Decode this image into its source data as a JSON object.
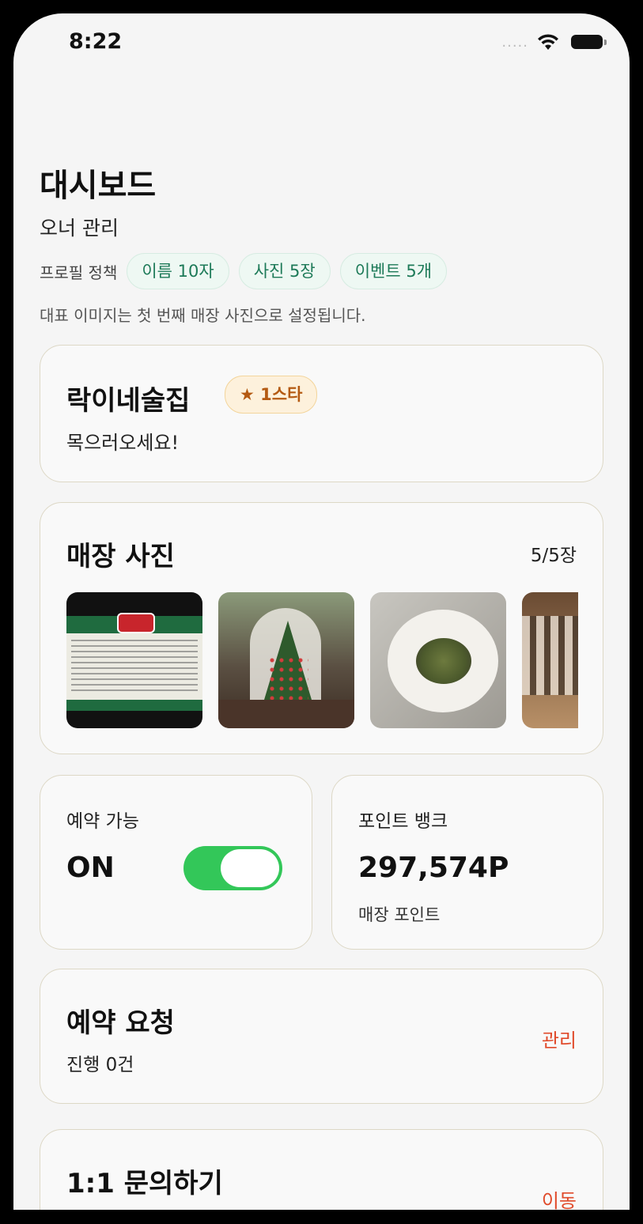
{
  "status": {
    "time": "8:22",
    "signal": "....."
  },
  "header": {
    "title": "대시보드",
    "subtitle": "오너 관리",
    "policy_label": "프로필 정책",
    "chips": [
      "이름 10자",
      "사진 5장",
      "이벤트 5개"
    ],
    "note": "대표 이미지는 첫 번째 매장 사진으로 설정됩니다."
  },
  "store": {
    "name": "락이네술집",
    "badge": "★ 1스타",
    "description": "목으러오세요!"
  },
  "photos": {
    "title": "매장 사진",
    "count": "5/5장"
  },
  "reservation": {
    "label": "예약 가능",
    "state": "ON",
    "enabled": true
  },
  "points": {
    "label": "포인트 뱅크",
    "value": "297,574P",
    "sub": "매장 포인트"
  },
  "requests": {
    "title": "예약 요청",
    "sub": "진행 0건",
    "link": "관리"
  },
  "inquiry": {
    "title": "1:1 문의하기",
    "link": "이동"
  },
  "colors": {
    "toggle_on": "#33c759",
    "link": "#e04a2a",
    "chip_text": "#1d7a58",
    "badge_text": "#b45a12"
  }
}
